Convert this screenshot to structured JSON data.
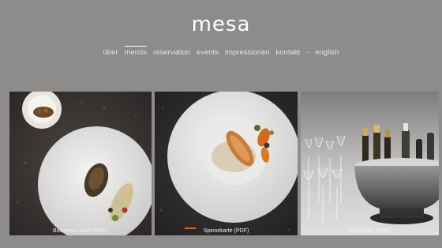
{
  "brand": {
    "logo": "mesa"
  },
  "nav": {
    "items": [
      {
        "label": "über",
        "active": false
      },
      {
        "label": "menüs",
        "active": true
      },
      {
        "label": "reservation",
        "active": false
      },
      {
        "label": "events",
        "active": false
      },
      {
        "label": "impressionen",
        "active": false
      },
      {
        "label": "kontakt",
        "active": false
      }
    ],
    "separator": "-",
    "language": "english"
  },
  "tiles": [
    {
      "caption": "Business Lunch (PDF)",
      "image": "appetizer-plate-photo"
    },
    {
      "caption": "Speisekarte (PDF)",
      "image": "main-course-plate-photo"
    },
    {
      "caption": "Weinkarte (PDF)",
      "image": "champagne-bucket-photo"
    }
  ]
}
